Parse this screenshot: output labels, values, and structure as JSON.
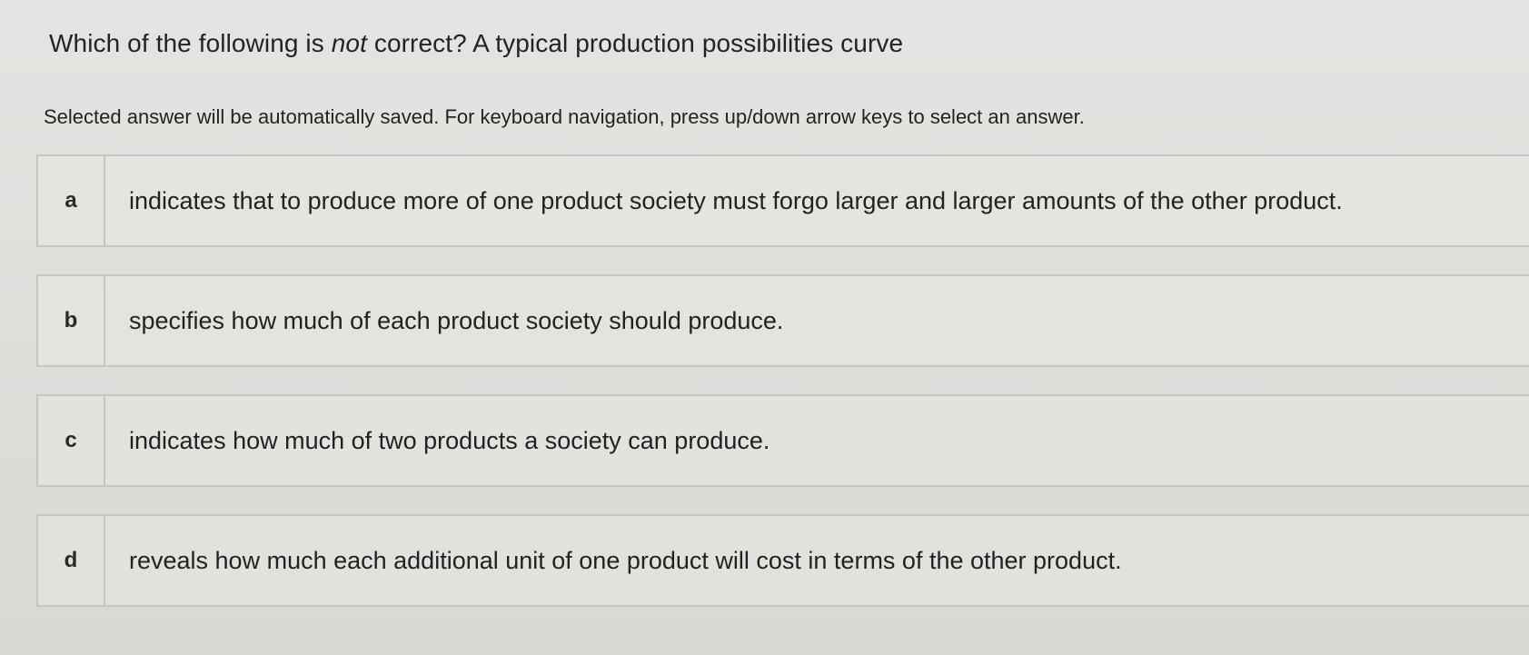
{
  "question": {
    "prefix": "Which of the following is ",
    "emphasis": "not",
    "suffix": " correct? A typical production possibilities curve"
  },
  "instructions": "Selected answer will be automatically saved. For keyboard navigation, press up/down arrow keys to select an answer.",
  "options": [
    {
      "letter": "a",
      "text": "indicates that to produce more of one product society must forgo larger and larger amounts of the other product."
    },
    {
      "letter": "b",
      "text": "specifies how much of each product society should produce."
    },
    {
      "letter": "c",
      "text": "indicates how much of two products a society can produce."
    },
    {
      "letter": "d",
      "text": "reveals how much each additional unit of one product will cost in terms of the other product."
    }
  ]
}
